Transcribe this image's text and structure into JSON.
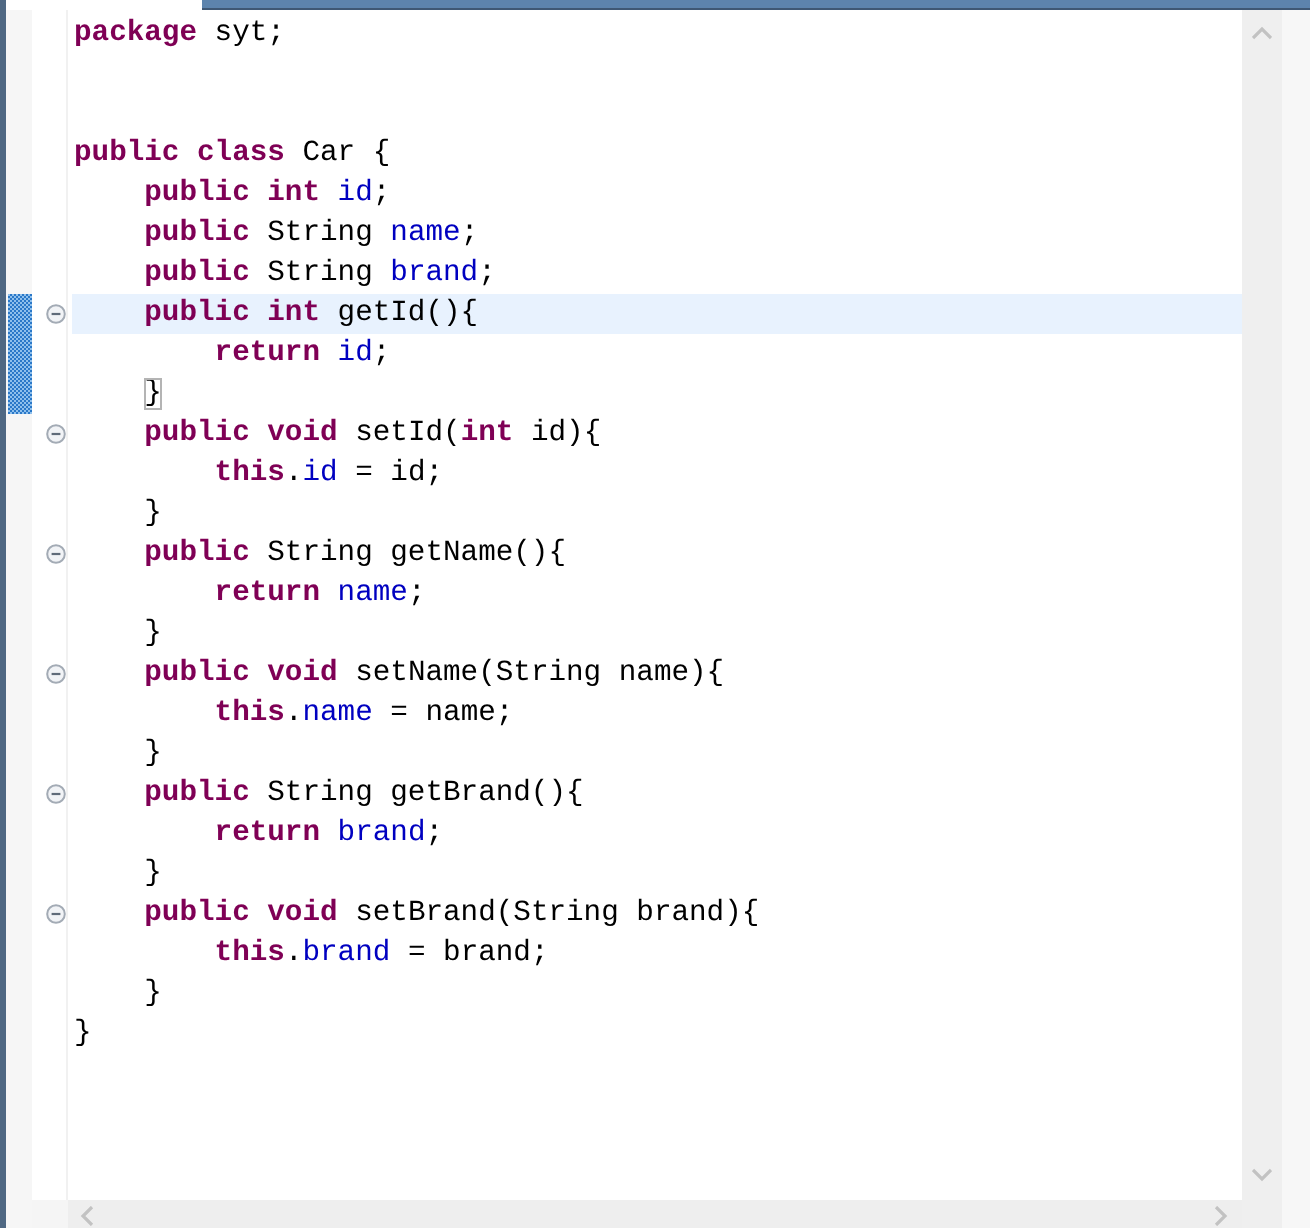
{
  "editor": {
    "lines": [
      {
        "kind": "code",
        "foldable": false,
        "current": false,
        "tokens": [
          {
            "text": "package",
            "kind": "keyword"
          },
          {
            "text": " syt;",
            "kind": "plain"
          }
        ]
      },
      {
        "kind": "blank"
      },
      {
        "kind": "blank"
      },
      {
        "kind": "code",
        "foldable": false,
        "current": false,
        "tokens": [
          {
            "text": "public class",
            "kind": "keyword"
          },
          {
            "text": " Car {",
            "kind": "plain"
          }
        ],
        "children": [
          {
            "kind": "code",
            "foldable": false,
            "current": false,
            "tokens": [
              {
                "text": "public int ",
                "kind": "keyword"
              },
              {
                "text": "id",
                "kind": "field"
              },
              {
                "text": ";",
                "kind": "plain"
              }
            ]
          },
          {
            "kind": "code",
            "foldable": false,
            "current": false,
            "tokens": [
              {
                "text": "public",
                "kind": "keyword"
              },
              {
                "text": " String ",
                "kind": "plain"
              },
              {
                "text": "name",
                "kind": "field"
              },
              {
                "text": ";",
                "kind": "plain"
              }
            ]
          },
          {
            "kind": "code",
            "foldable": false,
            "current": false,
            "tokens": [
              {
                "text": "public",
                "kind": "keyword"
              },
              {
                "text": " String ",
                "kind": "plain"
              },
              {
                "text": "brand",
                "kind": "field"
              },
              {
                "text": ";",
                "kind": "plain"
              }
            ]
          },
          {
            "kind": "code",
            "foldable": true,
            "current": true,
            "tokens": [
              {
                "text": "public int",
                "kind": "keyword"
              },
              {
                "text": " getId(){",
                "kind": "plain"
              }
            ],
            "children": [
              {
                "kind": "code",
                "foldable": false,
                "current": false,
                "tokens": [
                  {
                    "text": "return ",
                    "kind": "keyword"
                  },
                  {
                    "text": "id",
                    "kind": "field"
                  },
                  {
                    "text": ";",
                    "kind": "plain"
                  }
                ]
              }
            ],
            "closing": [
              {
                "text": "}",
                "kind": "matched-bracket"
              }
            ]
          },
          {
            "kind": "code",
            "foldable": true,
            "current": false,
            "tokens": [
              {
                "text": "public void",
                "kind": "keyword"
              },
              {
                "text": " setId(",
                "kind": "plain"
              },
              {
                "text": "int",
                "kind": "keyword"
              },
              {
                "text": " id){",
                "kind": "plain"
              }
            ],
            "children": [
              {
                "kind": "code",
                "foldable": false,
                "current": false,
                "tokens": [
                  {
                    "text": "this",
                    "kind": "keyword"
                  },
                  {
                    "text": ".",
                    "kind": "plain"
                  },
                  {
                    "text": "id",
                    "kind": "field"
                  },
                  {
                    "text": " = id;",
                    "kind": "plain"
                  }
                ]
              }
            ],
            "closing": [
              {
                "text": "}",
                "kind": "plain"
              }
            ]
          },
          {
            "kind": "code",
            "foldable": true,
            "current": false,
            "tokens": [
              {
                "text": "public",
                "kind": "keyword"
              },
              {
                "text": " String getName(){",
                "kind": "plain"
              }
            ],
            "children": [
              {
                "kind": "code",
                "foldable": false,
                "current": false,
                "tokens": [
                  {
                    "text": "return ",
                    "kind": "keyword"
                  },
                  {
                    "text": "name",
                    "kind": "field"
                  },
                  {
                    "text": ";",
                    "kind": "plain"
                  }
                ]
              }
            ],
            "closing": [
              {
                "text": "}",
                "kind": "plain"
              }
            ]
          },
          {
            "kind": "code",
            "foldable": true,
            "current": false,
            "tokens": [
              {
                "text": "public void",
                "kind": "keyword"
              },
              {
                "text": " setName(String name){",
                "kind": "plain"
              }
            ],
            "children": [
              {
                "kind": "code",
                "foldable": false,
                "current": false,
                "tokens": [
                  {
                    "text": "this",
                    "kind": "keyword"
                  },
                  {
                    "text": ".",
                    "kind": "plain"
                  },
                  {
                    "text": "name",
                    "kind": "field"
                  },
                  {
                    "text": " = name;",
                    "kind": "plain"
                  }
                ]
              }
            ],
            "closing": [
              {
                "text": "}",
                "kind": "plain"
              }
            ]
          },
          {
            "kind": "code",
            "foldable": true,
            "current": false,
            "tokens": [
              {
                "text": "public",
                "kind": "keyword"
              },
              {
                "text": " String getBrand(){",
                "kind": "plain"
              }
            ],
            "children": [
              {
                "kind": "code",
                "foldable": false,
                "current": false,
                "tokens": [
                  {
                    "text": "return ",
                    "kind": "keyword"
                  },
                  {
                    "text": "brand",
                    "kind": "field"
                  },
                  {
                    "text": ";",
                    "kind": "plain"
                  }
                ]
              }
            ],
            "closing": [
              {
                "text": "}",
                "kind": "plain"
              }
            ]
          },
          {
            "kind": "code",
            "foldable": true,
            "current": false,
            "tokens": [
              {
                "text": "public void",
                "kind": "keyword"
              },
              {
                "text": " setBrand(String brand){",
                "kind": "plain"
              }
            ],
            "children": [
              {
                "kind": "code",
                "foldable": false,
                "current": false,
                "tokens": [
                  {
                    "text": "this",
                    "kind": "keyword"
                  },
                  {
                    "text": ".",
                    "kind": "plain"
                  },
                  {
                    "text": "brand",
                    "kind": "field"
                  },
                  {
                    "text": " = brand;",
                    "kind": "plain"
                  }
                ]
              }
            ],
            "closing": [
              {
                "text": "}",
                "kind": "plain"
              }
            ]
          }
        ],
        "closing": [
          {
            "text": "}",
            "kind": "plain"
          }
        ]
      }
    ]
  }
}
